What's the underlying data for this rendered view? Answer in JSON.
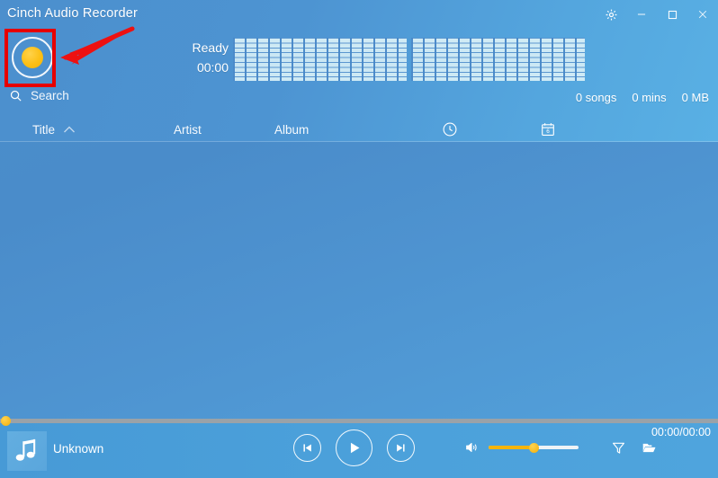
{
  "window": {
    "title": "Cinch Audio Recorder",
    "controls": [
      {
        "name": "settings-gear",
        "label": "Settings"
      },
      {
        "name": "minimize",
        "label": "Minimize"
      },
      {
        "name": "maximize",
        "label": "Maximize"
      },
      {
        "name": "close",
        "label": "Close"
      }
    ]
  },
  "recorder": {
    "record_button_label": "Record",
    "status": "Ready",
    "elapsed": "00:00",
    "accent_color": "#f5b40b",
    "annotation_color": "#e60000"
  },
  "search": {
    "placeholder": "Search",
    "value": "",
    "icon": "search-icon"
  },
  "library_stats": {
    "songs": "0 songs",
    "minutes": "0 mins",
    "size": "0 MB"
  },
  "columns": {
    "title": "Title",
    "artist": "Artist",
    "album": "Album",
    "duration_icon": "clock-icon",
    "date_icon": "calendar-icon",
    "sort_direction": "ascending"
  },
  "track_list": {
    "rows": []
  },
  "player": {
    "track_title": "Unknown",
    "time": "00:00/00:00",
    "progress_percent": 0,
    "volume_percent": 50,
    "previous_label": "Previous",
    "play_label": "Play",
    "next_label": "Next",
    "volume_icon": "speaker-icon",
    "filter_icon": "funnel-icon",
    "folder_icon": "folder-icon",
    "album_art_icon": "music-note-icon"
  },
  "theme": {
    "background_top": "#54a6de",
    "background_main": "#4a8ccc",
    "player_bar": "#4ba0da",
    "text": "#ffffff",
    "visualizer_cell": "#d4eef7"
  }
}
